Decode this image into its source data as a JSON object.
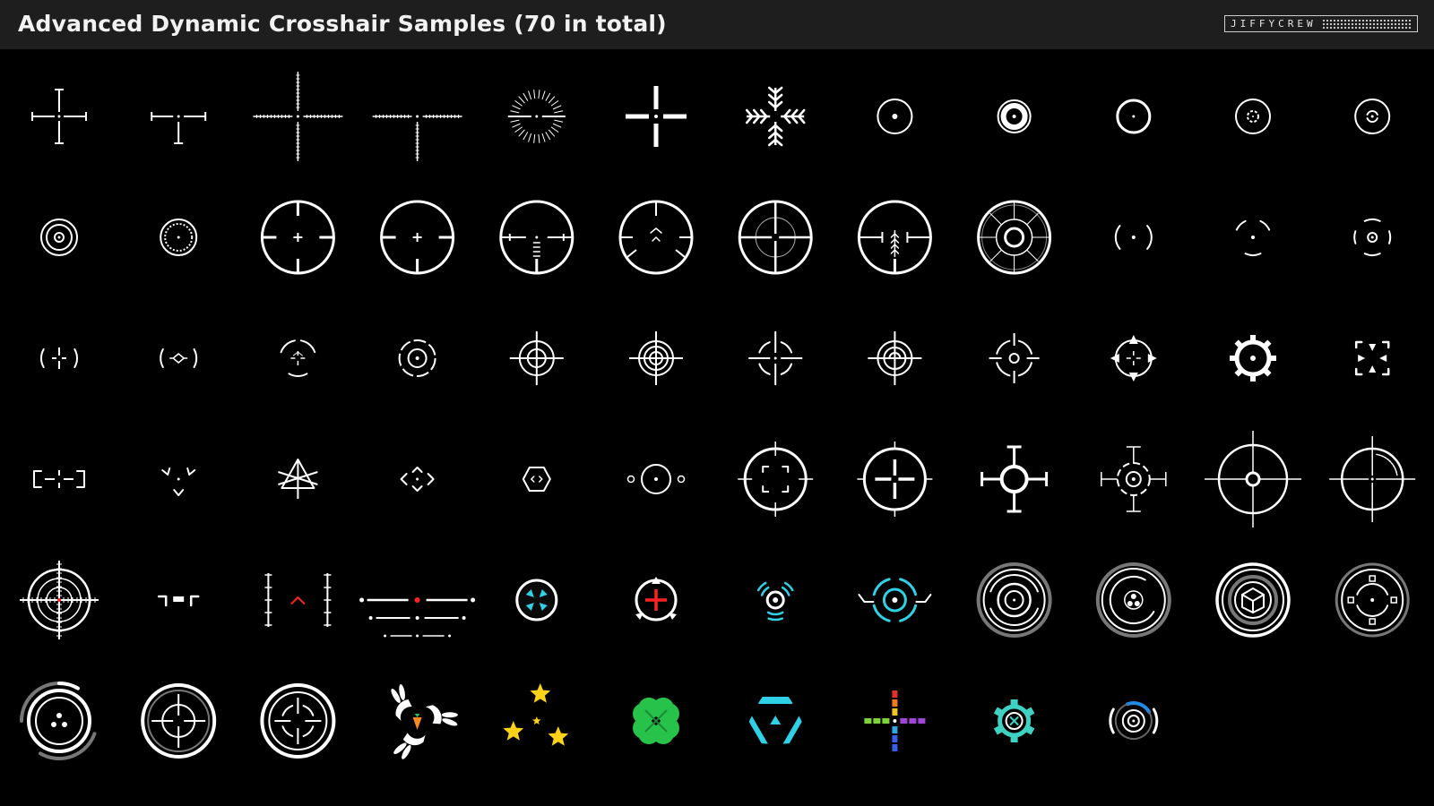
{
  "header": {
    "title": "Advanced Dynamic Crosshair Samples (70 in total)",
    "logo_text": "JIFFYCREW"
  },
  "colors": {
    "background": "#000000",
    "header": "#1e1e1e",
    "stroke": "#ffffff",
    "accent_cyan": "#2fd1e6",
    "accent_red": "#ff2222",
    "star_yellow": "#ffd21a",
    "clover_green": "#27c24a"
  },
  "crosshairs": [
    "plus-gap",
    "tee-gap",
    "plus-ticked",
    "tee-ticked",
    "sunburst",
    "bold-plus",
    "arrow-snowflake",
    "dot-ring",
    "thick-ring",
    "thin-ring-dot",
    "ring-tiny-circle",
    "ring-notch",
    "double-ring-dot",
    "ring-small-dot",
    "scope-plus",
    "scope-plus-thin",
    "scope-ladder",
    "scope-chevron",
    "scope-cross-inner",
    "scope-arrow",
    "scope-target",
    "paren-dot",
    "arc-pair-dot",
    "bracket-pair-dot",
    "broken-ring-plus",
    "paren-diamond",
    "broken-ring-cross",
    "dashed-double-ring",
    "cross-double-ring",
    "cross-triple-ring",
    "cross-ring-gap",
    "cross-ring-ticked",
    "gapped-ring-dot",
    "arrow-ring",
    "gear-dot",
    "corner-arrows",
    "bracket-dash",
    "v-chevrons",
    "triangle-cross",
    "diamond-chevrons",
    "hexagon-diamond",
    "ring-side-dots",
    "ring-corner-brackets",
    "thick-ring-cross",
    "pin-ring",
    "ring-crosshair-ticks",
    "large-cross-ring",
    "ring-dotted-quarter",
    "mil-scope",
    "bracket-bar",
    "rail-chevron",
    "line-stack",
    "cyan-fan-circle",
    "red-plus-triangles",
    "cyan-wave-dot",
    "cyan-arc-ring",
    "hud-arcs",
    "hud-dots",
    "hud-cube",
    "hud-squares",
    "thick-ring-dots",
    "double-ring-cross",
    "bold-ring-brackets",
    "rabbit-carrot",
    "three-stars",
    "four-leaf-clover",
    "cyan-segments",
    "rgb-cross",
    "teal-gear",
    "blue-arc-ring"
  ]
}
